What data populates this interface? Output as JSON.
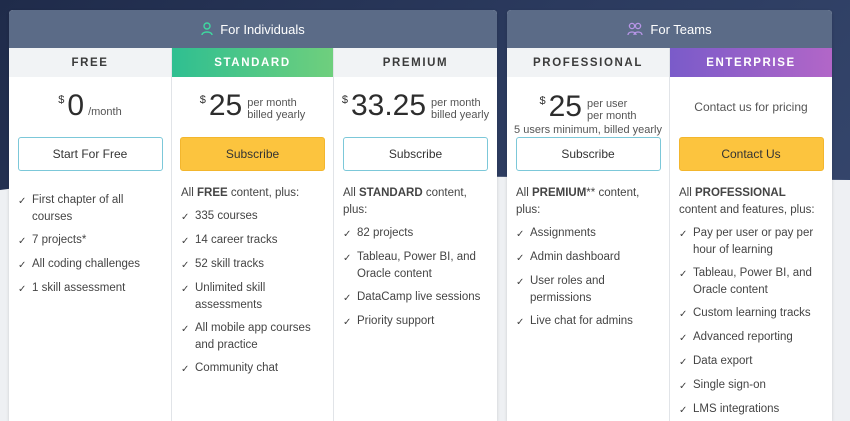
{
  "groups": {
    "individuals": {
      "label": "For Individuals",
      "icon": "person-icon"
    },
    "teams": {
      "label": "For Teams",
      "icon": "people-icon"
    }
  },
  "plans": {
    "free": {
      "name": "FREE",
      "currency": "$",
      "amount": "0",
      "period": "/month",
      "button": "Start For Free",
      "features": [
        "First chapter of all courses",
        "7 projects*",
        "All coding challenges",
        "1 skill assessment"
      ]
    },
    "standard": {
      "name": "STANDARD",
      "currency": "$",
      "amount": "25",
      "period_line1": "per month",
      "period_line2": "billed yearly",
      "button": "Subscribe",
      "intro_prefix": "All ",
      "intro_bold": "FREE",
      "intro_suffix": " content, plus:",
      "features": [
        "335 courses",
        "14 career tracks",
        "52 skill tracks",
        "Unlimited skill assessments",
        "All mobile app courses and practice",
        "Community chat"
      ]
    },
    "premium": {
      "name": "PREMIUM",
      "currency": "$",
      "amount": "33.25",
      "period_line1": "per month",
      "period_line2": "billed yearly",
      "button": "Subscribe",
      "intro_prefix": "All ",
      "intro_bold": "STANDARD",
      "intro_suffix": " content, plus:",
      "features": [
        "82 projects",
        "Tableau, Power BI, and Oracle content",
        "DataCamp live sessions",
        "Priority support"
      ]
    },
    "professional": {
      "name": "PROFESSIONAL",
      "currency": "$",
      "amount": "25",
      "period_line1": "per user",
      "period_line2": "per month",
      "sub": "5 users minimum, billed yearly",
      "button": "Subscribe",
      "intro_prefix": "All ",
      "intro_bold": "PREMIUM",
      "intro_suffix": "** content, plus:",
      "features": [
        "Assignments",
        "Admin dashboard",
        "User roles and permissions",
        "Live chat for admins"
      ]
    },
    "enterprise": {
      "name": "ENTERPRISE",
      "contact": "Contact us for pricing",
      "button": "Contact Us",
      "intro_prefix": "All ",
      "intro_bold": "PROFESSIONAL",
      "intro_suffix": " content and features, plus:",
      "features": [
        "Pay per user or pay per hour of learning",
        "Tableau, Power BI, and Oracle content",
        "Custom learning tracks",
        "Advanced reporting",
        "Data export",
        "Single sign-on",
        "LMS integrations"
      ]
    }
  },
  "colors": {
    "header_bg": "#5b6b87",
    "standard_gradient": [
      "#2fbf91",
      "#6fcf7d"
    ],
    "enterprise_gradient": [
      "#7a5bc9",
      "#b266c8"
    ],
    "yellow_button": "#fcc43e",
    "outline_button": "#7cc8d9"
  }
}
